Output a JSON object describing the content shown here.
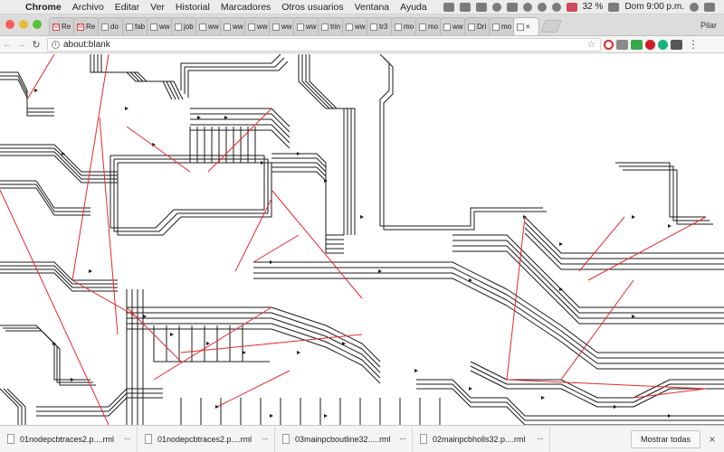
{
  "menubar": {
    "apple": "",
    "app_name": "Chrome",
    "items": [
      "Archivo",
      "Editar",
      "Ver",
      "Historial",
      "Marcadores",
      "Otros usuarios",
      "Ventana",
      "Ayuda"
    ],
    "battery": "32 %",
    "clock": "Dom 9:00 p.m."
  },
  "tabs": [
    {
      "label": "Re",
      "icon": "gmail-icon"
    },
    {
      "label": "Re",
      "icon": "gmail-icon"
    },
    {
      "label": "do",
      "icon": "doc-icon"
    },
    {
      "label": "fab",
      "icon": "doc-icon"
    },
    {
      "label": "ww",
      "icon": "page-icon"
    },
    {
      "label": "job",
      "icon": "page-icon"
    },
    {
      "label": "ww",
      "icon": "page-icon"
    },
    {
      "label": "ww",
      "icon": "youtube-icon"
    },
    {
      "label": "ww",
      "icon": "youtube-icon"
    },
    {
      "label": "ww",
      "icon": "page-icon"
    },
    {
      "label": "ww",
      "icon": "page-icon"
    },
    {
      "label": "trin",
      "icon": "page-icon"
    },
    {
      "label": "ww",
      "icon": "page-icon"
    },
    {
      "label": "tr3",
      "icon": "page-icon"
    },
    {
      "label": "mo",
      "icon": "page-icon"
    },
    {
      "label": "mo",
      "icon": "page-icon"
    },
    {
      "label": "ww",
      "icon": "page-icon"
    },
    {
      "label": "Dri",
      "icon": "drive-icon"
    },
    {
      "label": "mo",
      "icon": "page-icon"
    },
    {
      "label": "×",
      "icon": "page-icon"
    }
  ],
  "profile_name": "Pilar",
  "address_bar": {
    "url": "about:blank"
  },
  "downloads": [
    {
      "name": "01nodepcbtraces2.p....rml"
    },
    {
      "name": "01nodepcbtraces2.p....rml"
    },
    {
      "name": "03mainpcboutline32.....rml"
    },
    {
      "name": "02mainpcbholls32.p....rml"
    }
  ],
  "download_more": "···",
  "show_all_label": "Mostrar todas",
  "close_label": "×",
  "colors": {
    "trace": "#1a1a1a",
    "ratsnest": "#e8282b",
    "toolpath_bg": "#ffffff"
  }
}
